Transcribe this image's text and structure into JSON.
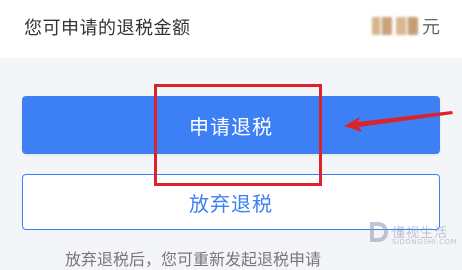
{
  "refund": {
    "label": "您可申请的退税金额",
    "unit": "元"
  },
  "buttons": {
    "apply_label": "申请退税",
    "abandon_label": "放弃退税"
  },
  "footer": {
    "text": "放弃退税后，您可重新发起退税申请"
  },
  "watermark": {
    "name": "懂视生活",
    "domain": "SIDONGSHI.COM"
  },
  "colors": {
    "primary": "#3d7ff5",
    "annotation": "#d9242b"
  },
  "icons": {
    "annotation_arrow": "red-arrow-icon",
    "watermark_logo": "d-logo-icon"
  }
}
